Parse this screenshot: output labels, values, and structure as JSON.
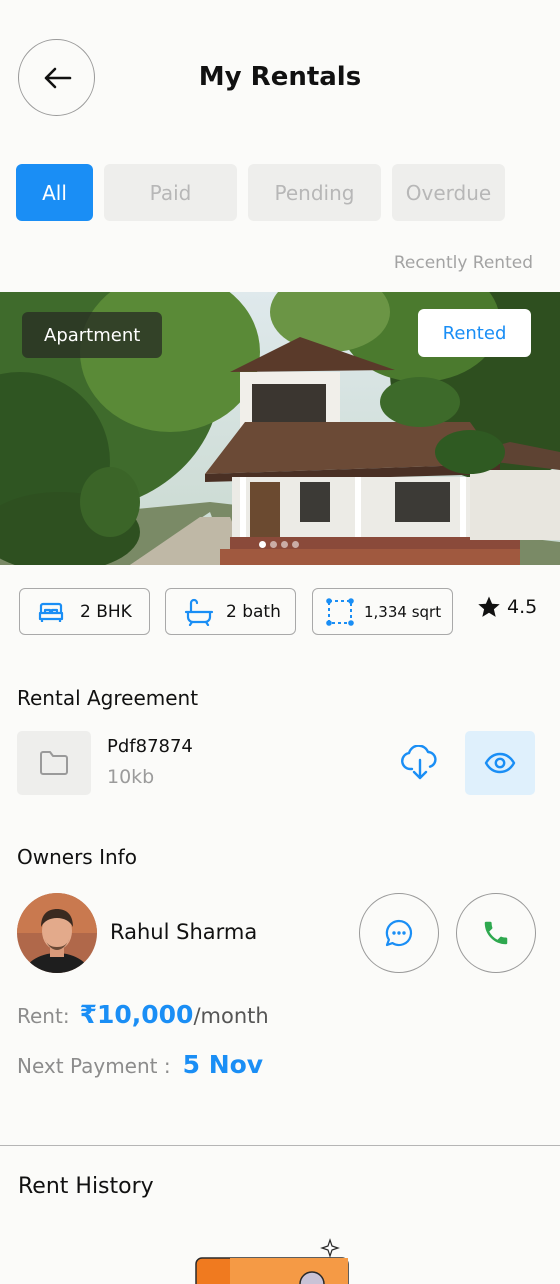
{
  "header": {
    "title": "My Rentals"
  },
  "filters": {
    "tabs": [
      "All",
      "Paid",
      "Pending",
      "Overdue"
    ],
    "active_index": 0
  },
  "recent_label": "Recently Rented",
  "property": {
    "type": "Apartment",
    "status": "Rented",
    "carousel": {
      "count": 4,
      "active": 0
    },
    "features": {
      "bedrooms": "2 BHK",
      "baths": "2 bath",
      "area": "1,334 sqrt"
    },
    "rating": "4.5"
  },
  "agreement": {
    "section_title": "Rental Agreement",
    "file_name": "Pdf87874",
    "file_size": "10kb"
  },
  "owner": {
    "section_title": "Owners Info",
    "name": "Rahul Sharma"
  },
  "rent": {
    "label": "Rent:",
    "amount": "₹10,000",
    "unit": "/month",
    "next_label": "Next Payment :",
    "next_date": "5 Nov"
  },
  "history": {
    "section_title": "Rent History"
  },
  "colors": {
    "accent": "#1a8ef5",
    "call": "#2ea84f",
    "view_bg": "#dff0fc"
  }
}
